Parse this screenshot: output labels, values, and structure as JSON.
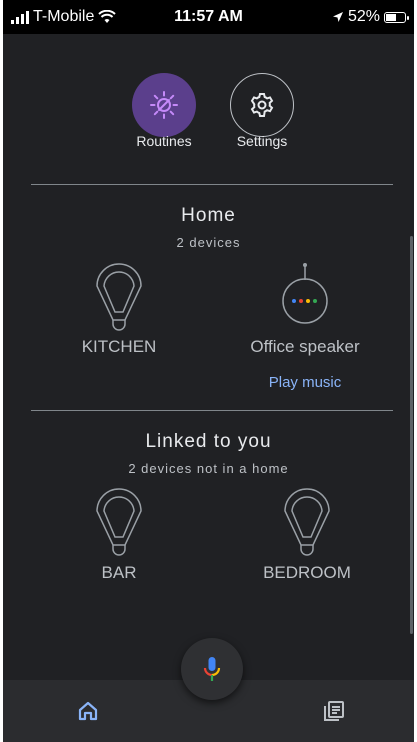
{
  "status_bar": {
    "carrier": "T-Mobile",
    "time": "11:57 AM",
    "battery": "52%",
    "battery_level": 0.52
  },
  "actions": {
    "routines_label": "Routines",
    "settings_label": "Settings",
    "routines_icon": "routines-sun-icon",
    "settings_icon": "gear-icon",
    "routines_color": "#5b3f8c"
  },
  "home": {
    "title": "Home",
    "subtitle": "2 devices",
    "devices": [
      {
        "label": "KITCHEN",
        "icon": "light-bulb-icon"
      },
      {
        "label": "Office speaker",
        "icon": "speaker-icon",
        "action": "Play music"
      }
    ]
  },
  "linked": {
    "title": "Linked to you",
    "subtitle": "2 devices not in a home",
    "devices": [
      {
        "label": "BAR",
        "icon": "light-bulb-icon"
      },
      {
        "label": "BEDROOM",
        "icon": "light-bulb-icon"
      }
    ]
  },
  "bottom_nav": {
    "home_icon": "home-icon",
    "feed_icon": "feed-icon",
    "mic_icon": "mic-icon",
    "accent": "#8ab4f8"
  }
}
